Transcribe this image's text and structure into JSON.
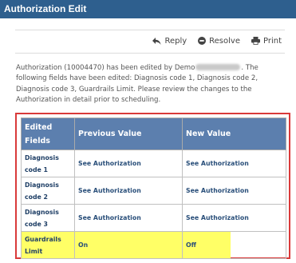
{
  "window": {
    "title": "Authorization Edit"
  },
  "actions": {
    "reply": "Reply",
    "resolve": "Resolve",
    "print": "Print"
  },
  "message": {
    "before": "Authorization (10004470) has been edited by Demo",
    "after": ". The following fields have been edited: Diagnosis code 1, Diagnosis code 2, Diagnosis code 3, Guardrails Limit. Please review the changes to the Authorization in detail prior to scheduling."
  },
  "table": {
    "headers": [
      "Edited Fields",
      "Previous Value",
      "New Value"
    ],
    "rows": [
      {
        "field": "Diagnosis code 1",
        "previous": "See Authorization",
        "new": "See Authorization"
      },
      {
        "field": "Diagnosis code 2",
        "previous": "See Authorization",
        "new": "See Authorization"
      },
      {
        "field": "Diagnosis code 3",
        "previous": "See Authorization",
        "new": "See Authorization"
      },
      {
        "field": "Guardrails Limit",
        "previous": "On",
        "new": "Off"
      }
    ]
  },
  "colors": {
    "title_bar": "#2e5f8e",
    "header": "#5c7fae",
    "highlight": "#ffff66",
    "outline": "#d93a3a"
  }
}
